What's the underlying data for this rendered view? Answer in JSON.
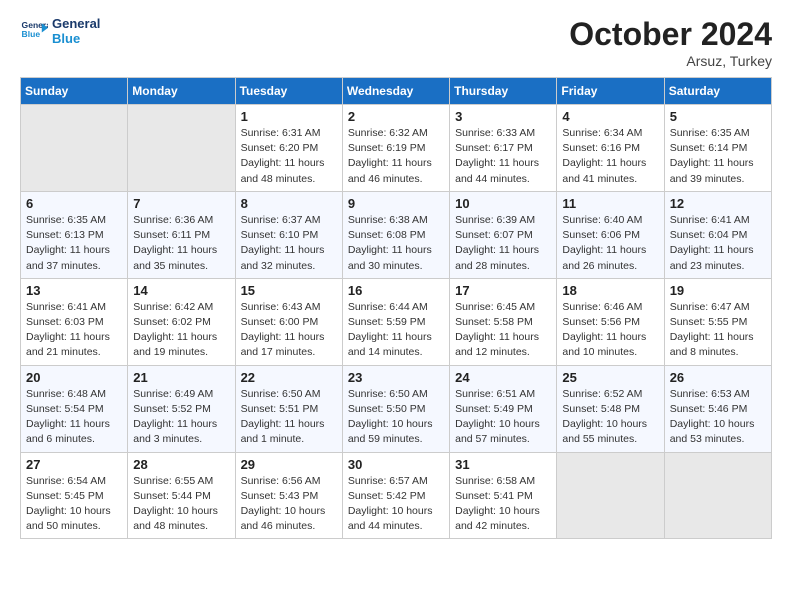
{
  "logo": {
    "line1": "General",
    "line2": "Blue"
  },
  "title": "October 2024",
  "subtitle": "Arsuz, Turkey",
  "header_days": [
    "Sunday",
    "Monday",
    "Tuesday",
    "Wednesday",
    "Thursday",
    "Friday",
    "Saturday"
  ],
  "weeks": [
    [
      {
        "num": "",
        "info": ""
      },
      {
        "num": "",
        "info": ""
      },
      {
        "num": "1",
        "info": "Sunrise: 6:31 AM\nSunset: 6:20 PM\nDaylight: 11 hours and 48 minutes."
      },
      {
        "num": "2",
        "info": "Sunrise: 6:32 AM\nSunset: 6:19 PM\nDaylight: 11 hours and 46 minutes."
      },
      {
        "num": "3",
        "info": "Sunrise: 6:33 AM\nSunset: 6:17 PM\nDaylight: 11 hours and 44 minutes."
      },
      {
        "num": "4",
        "info": "Sunrise: 6:34 AM\nSunset: 6:16 PM\nDaylight: 11 hours and 41 minutes."
      },
      {
        "num": "5",
        "info": "Sunrise: 6:35 AM\nSunset: 6:14 PM\nDaylight: 11 hours and 39 minutes."
      }
    ],
    [
      {
        "num": "6",
        "info": "Sunrise: 6:35 AM\nSunset: 6:13 PM\nDaylight: 11 hours and 37 minutes."
      },
      {
        "num": "7",
        "info": "Sunrise: 6:36 AM\nSunset: 6:11 PM\nDaylight: 11 hours and 35 minutes."
      },
      {
        "num": "8",
        "info": "Sunrise: 6:37 AM\nSunset: 6:10 PM\nDaylight: 11 hours and 32 minutes."
      },
      {
        "num": "9",
        "info": "Sunrise: 6:38 AM\nSunset: 6:08 PM\nDaylight: 11 hours and 30 minutes."
      },
      {
        "num": "10",
        "info": "Sunrise: 6:39 AM\nSunset: 6:07 PM\nDaylight: 11 hours and 28 minutes."
      },
      {
        "num": "11",
        "info": "Sunrise: 6:40 AM\nSunset: 6:06 PM\nDaylight: 11 hours and 26 minutes."
      },
      {
        "num": "12",
        "info": "Sunrise: 6:41 AM\nSunset: 6:04 PM\nDaylight: 11 hours and 23 minutes."
      }
    ],
    [
      {
        "num": "13",
        "info": "Sunrise: 6:41 AM\nSunset: 6:03 PM\nDaylight: 11 hours and 21 minutes."
      },
      {
        "num": "14",
        "info": "Sunrise: 6:42 AM\nSunset: 6:02 PM\nDaylight: 11 hours and 19 minutes."
      },
      {
        "num": "15",
        "info": "Sunrise: 6:43 AM\nSunset: 6:00 PM\nDaylight: 11 hours and 17 minutes."
      },
      {
        "num": "16",
        "info": "Sunrise: 6:44 AM\nSunset: 5:59 PM\nDaylight: 11 hours and 14 minutes."
      },
      {
        "num": "17",
        "info": "Sunrise: 6:45 AM\nSunset: 5:58 PM\nDaylight: 11 hours and 12 minutes."
      },
      {
        "num": "18",
        "info": "Sunrise: 6:46 AM\nSunset: 5:56 PM\nDaylight: 11 hours and 10 minutes."
      },
      {
        "num": "19",
        "info": "Sunrise: 6:47 AM\nSunset: 5:55 PM\nDaylight: 11 hours and 8 minutes."
      }
    ],
    [
      {
        "num": "20",
        "info": "Sunrise: 6:48 AM\nSunset: 5:54 PM\nDaylight: 11 hours and 6 minutes."
      },
      {
        "num": "21",
        "info": "Sunrise: 6:49 AM\nSunset: 5:52 PM\nDaylight: 11 hours and 3 minutes."
      },
      {
        "num": "22",
        "info": "Sunrise: 6:50 AM\nSunset: 5:51 PM\nDaylight: 11 hours and 1 minute."
      },
      {
        "num": "23",
        "info": "Sunrise: 6:50 AM\nSunset: 5:50 PM\nDaylight: 10 hours and 59 minutes."
      },
      {
        "num": "24",
        "info": "Sunrise: 6:51 AM\nSunset: 5:49 PM\nDaylight: 10 hours and 57 minutes."
      },
      {
        "num": "25",
        "info": "Sunrise: 6:52 AM\nSunset: 5:48 PM\nDaylight: 10 hours and 55 minutes."
      },
      {
        "num": "26",
        "info": "Sunrise: 6:53 AM\nSunset: 5:46 PM\nDaylight: 10 hours and 53 minutes."
      }
    ],
    [
      {
        "num": "27",
        "info": "Sunrise: 6:54 AM\nSunset: 5:45 PM\nDaylight: 10 hours and 50 minutes."
      },
      {
        "num": "28",
        "info": "Sunrise: 6:55 AM\nSunset: 5:44 PM\nDaylight: 10 hours and 48 minutes."
      },
      {
        "num": "29",
        "info": "Sunrise: 6:56 AM\nSunset: 5:43 PM\nDaylight: 10 hours and 46 minutes."
      },
      {
        "num": "30",
        "info": "Sunrise: 6:57 AM\nSunset: 5:42 PM\nDaylight: 10 hours and 44 minutes."
      },
      {
        "num": "31",
        "info": "Sunrise: 6:58 AM\nSunset: 5:41 PM\nDaylight: 10 hours and 42 minutes."
      },
      {
        "num": "",
        "info": ""
      },
      {
        "num": "",
        "info": ""
      }
    ]
  ]
}
